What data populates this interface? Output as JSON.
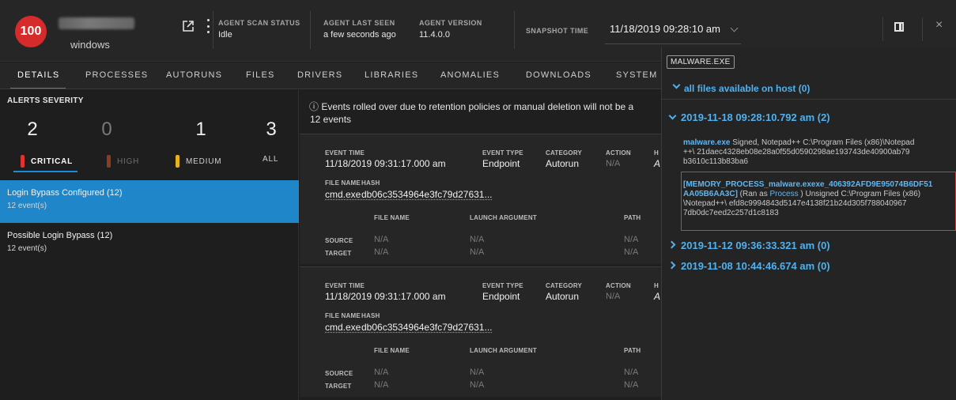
{
  "header": {
    "risk_score": "100",
    "host_os": "windows",
    "scan_status_label": "AGENT SCAN STATUS",
    "scan_status_value": "Idle",
    "last_seen_label": "AGENT LAST SEEN",
    "last_seen_value": "a few seconds ago",
    "version_label": "AGENT VERSION",
    "version_value": "11.4.0.0",
    "snapshot_label": "SNAPSHOT TIME",
    "snapshot_value": "11/18/2019 09:28:10 am",
    "close_glyph": "×"
  },
  "tabs": [
    "DETAILS",
    "PROCESSES",
    "AUTORUNS",
    "FILES",
    "DRIVERS",
    "LIBRARIES",
    "ANOMALIES",
    "DOWNLOADS",
    "SYSTEM"
  ],
  "severity": {
    "title": "ALERTS SEVERITY",
    "items": [
      {
        "count": "2",
        "label": "CRITICAL",
        "color": "#e0322f"
      },
      {
        "count": "0",
        "label": "HIGH",
        "color": "#8a3d22"
      },
      {
        "count": "1",
        "label": "MEDIUM",
        "color": "#e8b21d"
      },
      {
        "count": "3",
        "label": "ALL",
        "color": ""
      }
    ]
  },
  "alerts": [
    {
      "title": "Login Bypass Configured (12)",
      "sub": "12 event(s)"
    },
    {
      "title": "Possible Login Bypass (12)",
      "sub": "12 event(s)"
    }
  ],
  "events": {
    "notice": "ⓘ Events rolled over due to retention policies or manual deletion will not be a",
    "count": "12 events",
    "labels": {
      "event_time": "EVENT TIME",
      "event_type": "EVENT TYPE",
      "category": "CATEGORY",
      "action": "ACTION",
      "file_name": "FILE NAME",
      "hash": "HASH",
      "launch_argument": "LAUNCH ARGUMENT",
      "path": "PATH",
      "source": "SOURCE",
      "target": "TARGET",
      "cut_h": "H",
      "cut_a": "A"
    },
    "cards": [
      {
        "event_time": "11/18/2019 09:31:17.000 am",
        "event_type": "Endpoint",
        "category": "Autorun",
        "action": "N/A",
        "file_name": "cmd.exe",
        "hash": "db06c3534964e3fc79d27631...",
        "na": "N/A"
      },
      {
        "event_time": "11/18/2019 09:31:17.000 am",
        "event_type": "Endpoint",
        "category": "Autorun",
        "action": "N/A",
        "file_name": "cmd.exe",
        "hash": "db06c3534964e3fc79d27631...",
        "na": "N/A"
      }
    ]
  },
  "files_panel": {
    "tag": "MALWARE.EXE",
    "all_files": "all files available on host (0)",
    "groups": [
      {
        "date": "2019-11-18 09:28:10.792 am (2)"
      },
      {
        "date": "2019-11-12 09:36:33.321 am (0)"
      },
      {
        "date": "2019-11-08 10:44:46.674 am (0)"
      }
    ],
    "entry1": {
      "name": "malware.exe",
      "line1_rest": " Signed, Notepad++    C:\\Program Files (x86)\\Notepad",
      "line2": "++\\    21daec4328eb08e28a0f55d0590298ae193743de40900ab79",
      "line3": "b3610c113b83ba6"
    },
    "entry2": {
      "line1": "[MEMORY_PROCESS_malware.exexe_406392AFD9E95074B6DF51",
      "line2_name": "AA05B6AA3C]",
      "line2_paren_open": " (Ran as ",
      "line2_link": "Process",
      "line2_rest": " )   Unsigned    C:\\Program Files (x86)",
      "line3": "\\Notepad++\\    efd8c9994843d5147e4138f21b24d305f788040967",
      "line4": "7db0dc7eed2c257d1c8183"
    }
  }
}
